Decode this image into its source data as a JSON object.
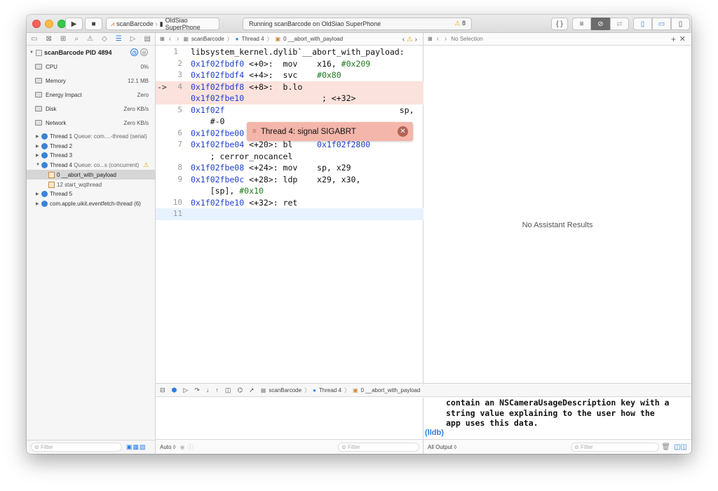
{
  "toolbar": {
    "scheme_app": "scanBarcode",
    "scheme_device": "OldSiao SuperPhone",
    "activity_text": "Running scanBarcode on OldSiao SuperPhone",
    "warning_count": "8",
    "braces_label": "{ }"
  },
  "navigator": {
    "process": {
      "name": "scanBarcode",
      "pid": "PID 4894"
    },
    "metrics": [
      {
        "name": "CPU",
        "value": "0%"
      },
      {
        "name": "Memory",
        "value": "12.1 MB"
      },
      {
        "name": "Energy Impact",
        "value": "Zero"
      },
      {
        "name": "Disk",
        "value": "Zero KB/s"
      },
      {
        "name": "Network",
        "value": "Zero KB/s"
      }
    ],
    "threads": [
      {
        "label": "Thread 1",
        "detail": "Queue: com....-thread (serial)"
      },
      {
        "label": "Thread 2",
        "detail": ""
      },
      {
        "label": "Thread 3",
        "detail": ""
      },
      {
        "label": "Thread 4",
        "detail": "Queue: co...s (concurrent)"
      }
    ],
    "frames": [
      {
        "label": "0 __abort_with_payload"
      },
      {
        "label": "12 start_wqthread"
      }
    ],
    "threads_after": [
      {
        "label": "Thread 5",
        "detail": ""
      },
      {
        "label": "com.apple.uikit.eventfetch-thread (6)",
        "detail": ""
      }
    ],
    "filter_placeholder": "Filter"
  },
  "editor": {
    "jumpbar": {
      "project": "scanBarcode",
      "thread": "Thread 4",
      "frame": "0 __abort_with_payload"
    },
    "lines": [
      {
        "n": "1",
        "a": "",
        "t": "libsystem_kernel.dylib`__abort_with_payload:",
        "op": "",
        "arg": ""
      },
      {
        "n": "2",
        "a": "0x1f02fbdf0",
        "t": " <+0>:  mov    ",
        "op": "x16, ",
        "arg": "#0x209"
      },
      {
        "n": "3",
        "a": "0x1f02fbdf4",
        "t": " <+4>:  svc    ",
        "op": "",
        "arg": "#0x80"
      },
      {
        "n": "4",
        "a": "0x1f02fbdf8",
        "t": " <+8>:  b.lo",
        "op": "",
        "arg": ""
      },
      {
        "n": "",
        "a": "0x1f02fbe10",
        "t": "                ; <+32>",
        "op": "",
        "arg": ""
      },
      {
        "n": "5",
        "a": "0x1f02f",
        "t": "                                    sp,",
        "op": "",
        "arg": ""
      },
      {
        "n": "",
        "a": "",
        "t": "    #-0",
        "op": "",
        "arg": ""
      },
      {
        "n": "6",
        "a": "0x1f02fbe00",
        "t": " <+16>: mov    x29, sp",
        "op": "",
        "arg": ""
      },
      {
        "n": "7",
        "a": "0x1f02fbe04",
        "t": " <+20>: bl     ",
        "op": "",
        "arg": "",
        "addr2": "0x1f02f2800"
      },
      {
        "n": "",
        "a": "",
        "t": "    ; cerror_nocancel",
        "op": "",
        "arg": ""
      },
      {
        "n": "8",
        "a": "0x1f02fbe08",
        "t": " <+24>: mov    sp, x29",
        "op": "",
        "arg": ""
      },
      {
        "n": "9",
        "a": "0x1f02fbe0c",
        "t": " <+28>: ldp    x29, x30,",
        "op": "",
        "arg": ""
      },
      {
        "n": "",
        "a": "",
        "t": "    [sp], ",
        "op": "",
        "arg": "#0x10"
      },
      {
        "n": "10",
        "a": "0x1f02fbe10",
        "t": " <+32>: ret",
        "op": "",
        "arg": ""
      },
      {
        "n": "11",
        "a": "",
        "t": "",
        "op": "",
        "arg": ""
      }
    ],
    "banner": "Thread 4: signal SIGABRT",
    "current_marker": "->"
  },
  "assistant": {
    "selection": "No Selection",
    "empty_message": "No Assistant Results"
  },
  "debug": {
    "project": "scanBarcode",
    "thread": "Thread 4",
    "frame": "0 __abort_with_payload",
    "auto_label": "Auto ◊",
    "filter_placeholder": "Filter",
    "output_label": "All Output ◊",
    "console_lines": [
      "contain an NSCameraUsageDescription key with a",
      "string value explaining to the user how the",
      "app uses this data."
    ],
    "prompt": "(lldb)"
  }
}
